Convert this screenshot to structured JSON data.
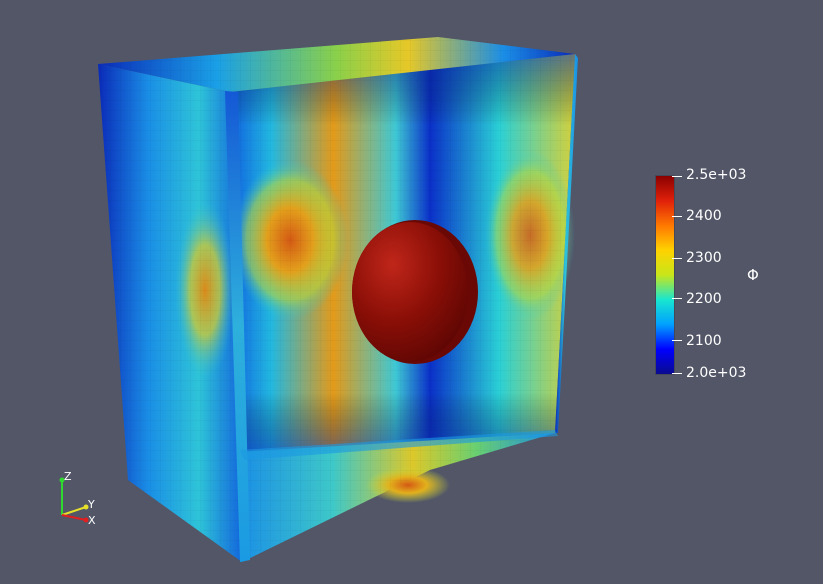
{
  "render": {
    "background": "#525667",
    "field_colormap": "jet (blue-green-yellow-red)",
    "sphere_color": "#8b0f07"
  },
  "colorbar": {
    "title": "Φ",
    "min_label": "2.0e+03",
    "max_label": "2.5e+03",
    "ticks": [
      "2100",
      "2200",
      "2300",
      "2400"
    ],
    "range": [
      2000,
      2500
    ],
    "colors": [
      "#0a0a8f",
      "#0000ff",
      "#00a0ff",
      "#18e6d0",
      "#c8e61a",
      "#ffd200",
      "#ff7800",
      "#e0200a",
      "#8b0000"
    ]
  },
  "orientation_axes": {
    "labels": [
      "Z",
      "Y",
      "X"
    ],
    "icon": "orientation-axes-icon"
  }
}
